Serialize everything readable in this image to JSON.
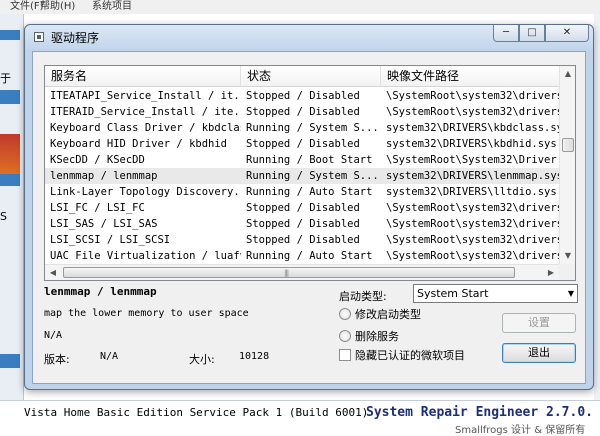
{
  "background": {
    "menubar": [
      "文件(F)",
      "帮助(H)"
    ],
    "menu_item_partial": "系统项目",
    "left_text_1": "于",
    "left_text_2": "S",
    "status_left": "Vista Home Basic Edition Service Pack 1 (Build 6001)",
    "status_right": "System Repair Engineer 2.7.0.",
    "status_sub": "Smallfrogs 设计 & 保留所有"
  },
  "dialog": {
    "title": "驱动程序",
    "columns": [
      "服务名",
      "状态",
      "映像文件路径"
    ],
    "rows": [
      {
        "name": "ITEATAPI_Service_Install / it...",
        "status": "Stopped / Disabled",
        "path": "\\SystemRoot\\system32\\drivers"
      },
      {
        "name": "ITERAID_Service_Install / ite...",
        "status": "Stopped / Disabled",
        "path": "\\SystemRoot\\system32\\drivers"
      },
      {
        "name": "Keyboard Class Driver / kbdclass",
        "status": "Running / System S...",
        "path": "system32\\DRIVERS\\kbdclass.sy"
      },
      {
        "name": "Keyboard HID Driver / kbdhid",
        "status": "Stopped / Disabled",
        "path": "system32\\DRIVERS\\kbdhid.sys"
      },
      {
        "name": "KSecDD / KSecDD",
        "status": "Running / Boot Start",
        "path": "\\SystemRoot\\System32\\Driver"
      },
      {
        "name": "lenmmap / lenmmap",
        "status": "Running / System S...",
        "path": "system32\\DRIVERS\\lenmmap.sys"
      },
      {
        "name": "Link-Layer Topology Discovery...",
        "status": "Running / Auto Start",
        "path": "system32\\DRIVERS\\lltdio.sys"
      },
      {
        "name": "LSI_FC / LSI_FC",
        "status": "Stopped / Disabled",
        "path": "\\SystemRoot\\system32\\drivers"
      },
      {
        "name": "LSI_SAS / LSI_SAS",
        "status": "Stopped / Disabled",
        "path": "\\SystemRoot\\system32\\drivers"
      },
      {
        "name": "LSI_SCSI / LSI_SCSI",
        "status": "Stopped / Disabled",
        "path": "\\SystemRoot\\system32\\drivers"
      },
      {
        "name": "UAC File Virtualization / luafv",
        "status": "Running / Auto Start",
        "path": "\\SystemRoot\\system32\\drivers"
      }
    ],
    "selected_row_index": 5,
    "detail": {
      "name": "lenmmap / lenmmap",
      "description": "map the lower memory to user space",
      "company": "N/A",
      "version_label": "版本:",
      "version_value": "N/A",
      "size_label": "大小:",
      "size_value": "10128"
    },
    "start_type_label": "启动类型:",
    "start_type_value": "System Start",
    "options": {
      "modify_start_type": "修改启动类型",
      "delete_service": "删除服务",
      "hide_microsoft": "隐藏已认证的微软项目"
    },
    "buttons": {
      "settings": "设置",
      "exit": "退出"
    },
    "icons": {
      "minimize": "─",
      "maximize": "□",
      "close": "✕",
      "scroll_up": "▲",
      "scroll_down": "▼",
      "scroll_left": "◀",
      "scroll_right": "▶",
      "dropdown": "▼",
      "grip": "|||"
    }
  }
}
